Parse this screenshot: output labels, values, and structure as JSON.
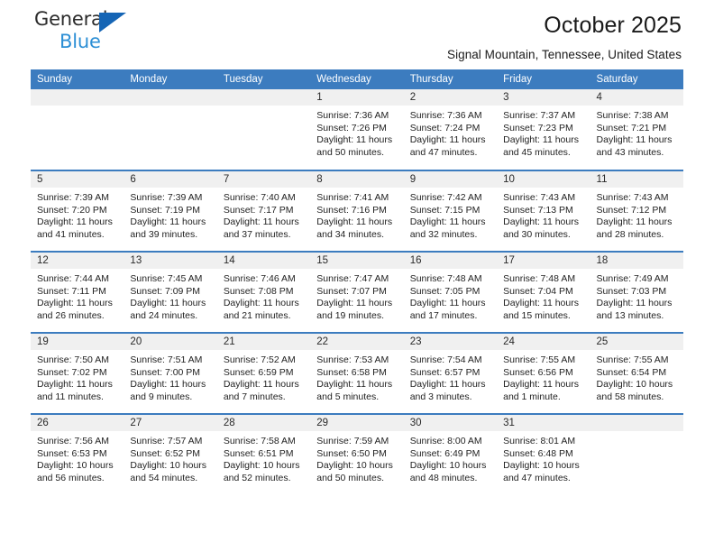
{
  "logo": {
    "word_one": "General",
    "word_two": "Blue",
    "triangle_color": "#1565b5",
    "blue_color": "#2d8fd5"
  },
  "header": {
    "title": "October 2025",
    "subtitle": "Signal Mountain, Tennessee, United States"
  },
  "theme": {
    "header_blue": "#3c7cbf",
    "daynum_bg": "#f0f0f0",
    "text": "#1a1a1a"
  },
  "calendar": {
    "weekday_headers": [
      "Sunday",
      "Monday",
      "Tuesday",
      "Wednesday",
      "Thursday",
      "Friday",
      "Saturday"
    ],
    "weeks": [
      [
        {
          "day": "",
          "sunrise": "",
          "sunset": "",
          "daylight_1": "",
          "daylight_2": "",
          "empty": true
        },
        {
          "day": "",
          "sunrise": "",
          "sunset": "",
          "daylight_1": "",
          "daylight_2": "",
          "empty": true
        },
        {
          "day": "",
          "sunrise": "",
          "sunset": "",
          "daylight_1": "",
          "daylight_2": "",
          "empty": true
        },
        {
          "day": "1",
          "sunrise": "Sunrise: 7:36 AM",
          "sunset": "Sunset: 7:26 PM",
          "daylight_1": "Daylight: 11 hours",
          "daylight_2": "and 50 minutes.",
          "empty": false
        },
        {
          "day": "2",
          "sunrise": "Sunrise: 7:36 AM",
          "sunset": "Sunset: 7:24 PM",
          "daylight_1": "Daylight: 11 hours",
          "daylight_2": "and 47 minutes.",
          "empty": false
        },
        {
          "day": "3",
          "sunrise": "Sunrise: 7:37 AM",
          "sunset": "Sunset: 7:23 PM",
          "daylight_1": "Daylight: 11 hours",
          "daylight_2": "and 45 minutes.",
          "empty": false
        },
        {
          "day": "4",
          "sunrise": "Sunrise: 7:38 AM",
          "sunset": "Sunset: 7:21 PM",
          "daylight_1": "Daylight: 11 hours",
          "daylight_2": "and 43 minutes.",
          "empty": false
        }
      ],
      [
        {
          "day": "5",
          "sunrise": "Sunrise: 7:39 AM",
          "sunset": "Sunset: 7:20 PM",
          "daylight_1": "Daylight: 11 hours",
          "daylight_2": "and 41 minutes.",
          "empty": false
        },
        {
          "day": "6",
          "sunrise": "Sunrise: 7:39 AM",
          "sunset": "Sunset: 7:19 PM",
          "daylight_1": "Daylight: 11 hours",
          "daylight_2": "and 39 minutes.",
          "empty": false
        },
        {
          "day": "7",
          "sunrise": "Sunrise: 7:40 AM",
          "sunset": "Sunset: 7:17 PM",
          "daylight_1": "Daylight: 11 hours",
          "daylight_2": "and 37 minutes.",
          "empty": false
        },
        {
          "day": "8",
          "sunrise": "Sunrise: 7:41 AM",
          "sunset": "Sunset: 7:16 PM",
          "daylight_1": "Daylight: 11 hours",
          "daylight_2": "and 34 minutes.",
          "empty": false
        },
        {
          "day": "9",
          "sunrise": "Sunrise: 7:42 AM",
          "sunset": "Sunset: 7:15 PM",
          "daylight_1": "Daylight: 11 hours",
          "daylight_2": "and 32 minutes.",
          "empty": false
        },
        {
          "day": "10",
          "sunrise": "Sunrise: 7:43 AM",
          "sunset": "Sunset: 7:13 PM",
          "daylight_1": "Daylight: 11 hours",
          "daylight_2": "and 30 minutes.",
          "empty": false
        },
        {
          "day": "11",
          "sunrise": "Sunrise: 7:43 AM",
          "sunset": "Sunset: 7:12 PM",
          "daylight_1": "Daylight: 11 hours",
          "daylight_2": "and 28 minutes.",
          "empty": false
        }
      ],
      [
        {
          "day": "12",
          "sunrise": "Sunrise: 7:44 AM",
          "sunset": "Sunset: 7:11 PM",
          "daylight_1": "Daylight: 11 hours",
          "daylight_2": "and 26 minutes.",
          "empty": false
        },
        {
          "day": "13",
          "sunrise": "Sunrise: 7:45 AM",
          "sunset": "Sunset: 7:09 PM",
          "daylight_1": "Daylight: 11 hours",
          "daylight_2": "and 24 minutes.",
          "empty": false
        },
        {
          "day": "14",
          "sunrise": "Sunrise: 7:46 AM",
          "sunset": "Sunset: 7:08 PM",
          "daylight_1": "Daylight: 11 hours",
          "daylight_2": "and 21 minutes.",
          "empty": false
        },
        {
          "day": "15",
          "sunrise": "Sunrise: 7:47 AM",
          "sunset": "Sunset: 7:07 PM",
          "daylight_1": "Daylight: 11 hours",
          "daylight_2": "and 19 minutes.",
          "empty": false
        },
        {
          "day": "16",
          "sunrise": "Sunrise: 7:48 AM",
          "sunset": "Sunset: 7:05 PM",
          "daylight_1": "Daylight: 11 hours",
          "daylight_2": "and 17 minutes.",
          "empty": false
        },
        {
          "day": "17",
          "sunrise": "Sunrise: 7:48 AM",
          "sunset": "Sunset: 7:04 PM",
          "daylight_1": "Daylight: 11 hours",
          "daylight_2": "and 15 minutes.",
          "empty": false
        },
        {
          "day": "18",
          "sunrise": "Sunrise: 7:49 AM",
          "sunset": "Sunset: 7:03 PM",
          "daylight_1": "Daylight: 11 hours",
          "daylight_2": "and 13 minutes.",
          "empty": false
        }
      ],
      [
        {
          "day": "19",
          "sunrise": "Sunrise: 7:50 AM",
          "sunset": "Sunset: 7:02 PM",
          "daylight_1": "Daylight: 11 hours",
          "daylight_2": "and 11 minutes.",
          "empty": false
        },
        {
          "day": "20",
          "sunrise": "Sunrise: 7:51 AM",
          "sunset": "Sunset: 7:00 PM",
          "daylight_1": "Daylight: 11 hours",
          "daylight_2": "and 9 minutes.",
          "empty": false
        },
        {
          "day": "21",
          "sunrise": "Sunrise: 7:52 AM",
          "sunset": "Sunset: 6:59 PM",
          "daylight_1": "Daylight: 11 hours",
          "daylight_2": "and 7 minutes.",
          "empty": false
        },
        {
          "day": "22",
          "sunrise": "Sunrise: 7:53 AM",
          "sunset": "Sunset: 6:58 PM",
          "daylight_1": "Daylight: 11 hours",
          "daylight_2": "and 5 minutes.",
          "empty": false
        },
        {
          "day": "23",
          "sunrise": "Sunrise: 7:54 AM",
          "sunset": "Sunset: 6:57 PM",
          "daylight_1": "Daylight: 11 hours",
          "daylight_2": "and 3 minutes.",
          "empty": false
        },
        {
          "day": "24",
          "sunrise": "Sunrise: 7:55 AM",
          "sunset": "Sunset: 6:56 PM",
          "daylight_1": "Daylight: 11 hours",
          "daylight_2": "and 1 minute.",
          "empty": false
        },
        {
          "day": "25",
          "sunrise": "Sunrise: 7:55 AM",
          "sunset": "Sunset: 6:54 PM",
          "daylight_1": "Daylight: 10 hours",
          "daylight_2": "and 58 minutes.",
          "empty": false
        }
      ],
      [
        {
          "day": "26",
          "sunrise": "Sunrise: 7:56 AM",
          "sunset": "Sunset: 6:53 PM",
          "daylight_1": "Daylight: 10 hours",
          "daylight_2": "and 56 minutes.",
          "empty": false
        },
        {
          "day": "27",
          "sunrise": "Sunrise: 7:57 AM",
          "sunset": "Sunset: 6:52 PM",
          "daylight_1": "Daylight: 10 hours",
          "daylight_2": "and 54 minutes.",
          "empty": false
        },
        {
          "day": "28",
          "sunrise": "Sunrise: 7:58 AM",
          "sunset": "Sunset: 6:51 PM",
          "daylight_1": "Daylight: 10 hours",
          "daylight_2": "and 52 minutes.",
          "empty": false
        },
        {
          "day": "29",
          "sunrise": "Sunrise: 7:59 AM",
          "sunset": "Sunset: 6:50 PM",
          "daylight_1": "Daylight: 10 hours",
          "daylight_2": "and 50 minutes.",
          "empty": false
        },
        {
          "day": "30",
          "sunrise": "Sunrise: 8:00 AM",
          "sunset": "Sunset: 6:49 PM",
          "daylight_1": "Daylight: 10 hours",
          "daylight_2": "and 48 minutes.",
          "empty": false
        },
        {
          "day": "31",
          "sunrise": "Sunrise: 8:01 AM",
          "sunset": "Sunset: 6:48 PM",
          "daylight_1": "Daylight: 10 hours",
          "daylight_2": "and 47 minutes.",
          "empty": false
        },
        {
          "day": "",
          "sunrise": "",
          "sunset": "",
          "daylight_1": "",
          "daylight_2": "",
          "empty": true
        }
      ]
    ]
  }
}
